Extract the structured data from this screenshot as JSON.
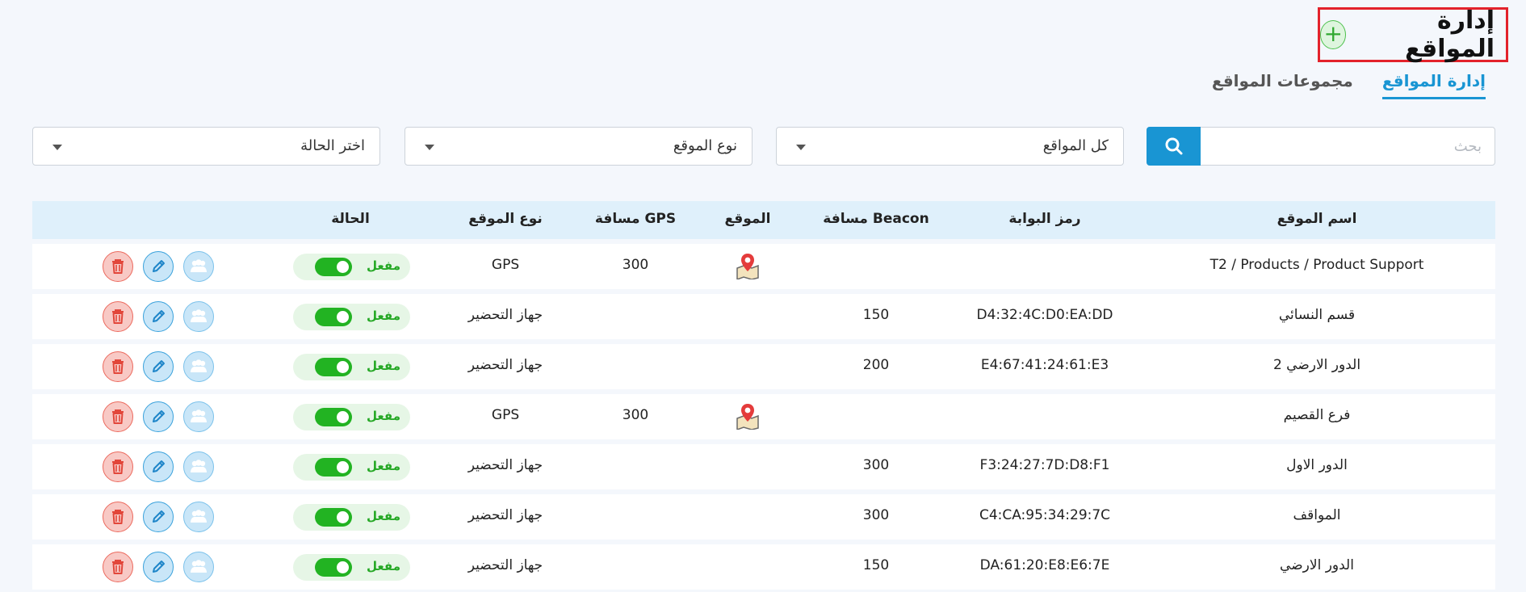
{
  "page": {
    "title": "إدارة المواقع",
    "add_label": "+"
  },
  "tabs": [
    {
      "label": "إدارة المواقع",
      "active": true
    },
    {
      "label": "مجموعات المواقع",
      "active": false
    }
  ],
  "filters": {
    "search_placeholder": "بحث",
    "sites_select": "كل المواقع",
    "type_select": "نوع الموقع",
    "status_select": "اختر الحالة"
  },
  "table": {
    "headers": {
      "name": "اسم الموقع",
      "gate": "رمز البوابة",
      "beacon": "مسافة Beacon",
      "location": "الموقع",
      "gps": "مسافة GPS",
      "type": "نوع الموقع",
      "status": "الحالة"
    },
    "rows": [
      {
        "name": "T2 / Products / Product Support",
        "gate": "",
        "beacon": "",
        "has_map": true,
        "gps": "300",
        "type": "GPS",
        "status": "مفعل"
      },
      {
        "name": "قسم النسائي",
        "gate": "D4:32:4C:D0:EA:DD",
        "beacon": "150",
        "has_map": false,
        "gps": "",
        "type": "جهاز التحضير",
        "status": "مفعل"
      },
      {
        "name": "الدور الارضي 2",
        "gate": "E4:67:41:24:61:E3",
        "beacon": "200",
        "has_map": false,
        "gps": "",
        "type": "جهاز التحضير",
        "status": "مفعل"
      },
      {
        "name": "فرع القصيم",
        "gate": "",
        "beacon": "",
        "has_map": true,
        "gps": "300",
        "type": "GPS",
        "status": "مفعل"
      },
      {
        "name": "الدور الاول",
        "gate": "F3:24:27:7D:D8:F1",
        "beacon": "300",
        "has_map": false,
        "gps": "",
        "type": "جهاز التحضير",
        "status": "مفعل"
      },
      {
        "name": "المواقف",
        "gate": "C4:CA:95:34:29:7C",
        "beacon": "300",
        "has_map": false,
        "gps": "",
        "type": "جهاز التحضير",
        "status": "مفعل"
      },
      {
        "name": "الدور الارضي",
        "gate": "DA:61:20:E8:E6:7E",
        "beacon": "150",
        "has_map": false,
        "gps": "",
        "type": "جهاز التحضير",
        "status": "مفعل"
      }
    ]
  },
  "colors": {
    "accent": "#1995d3",
    "active_green": "#22b322",
    "delete_red": "#ec6a5e",
    "header_highlight": "#e3222b"
  }
}
